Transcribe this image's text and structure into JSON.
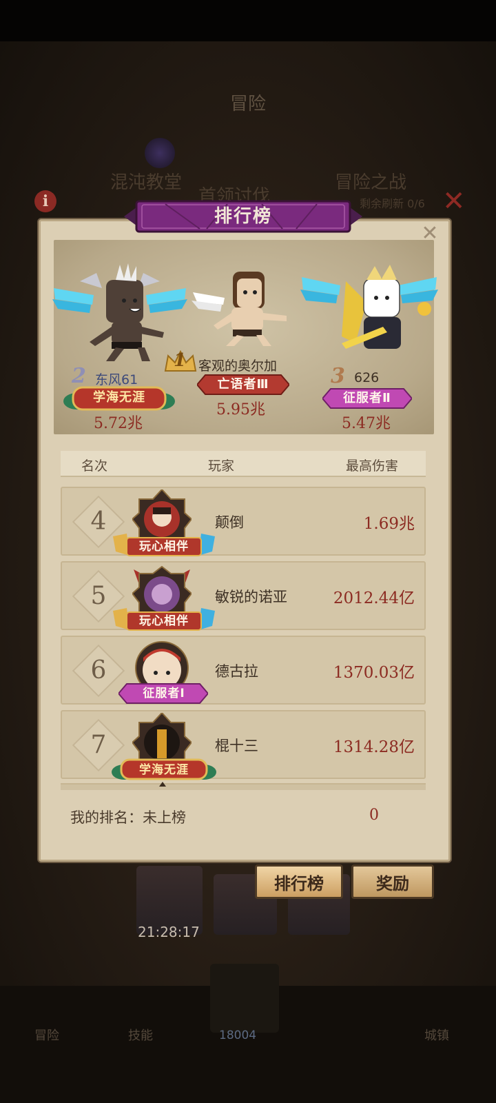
{
  "background": {
    "screen_title": "冒险",
    "left_label": "混沌教堂",
    "center_label": "首领讨伐",
    "right_label": "冒险之战",
    "right_sub": "剩余刷新 0/6",
    "timer": "21:28:17",
    "tabs": {
      "leaderboard": "排行榜",
      "rewards": "奖励"
    },
    "nav": {
      "left": "冒险",
      "second": "技能",
      "center_count": "18004",
      "right": "城镇"
    }
  },
  "panel": {
    "banner": "排行榜",
    "close_icon": "close-icon"
  },
  "podium": [
    {
      "rank": "2",
      "name": "东风61",
      "title": "学海无涯",
      "damage": "5.72兆"
    },
    {
      "rank": "1",
      "name": "客观的奥尔加",
      "title": "亡语者Ⅲ",
      "damage": "5.95兆"
    },
    {
      "rank": "3",
      "name": "626",
      "title": "征服者Ⅱ",
      "damage": "5.47兆"
    }
  ],
  "table": {
    "headers": {
      "rank": "名次",
      "player": "玩家",
      "damage": "最高伤害"
    },
    "rows": [
      {
        "rank": "4",
        "name": "颠倒",
        "title": "玩心相伴",
        "damage": "1.69兆"
      },
      {
        "rank": "5",
        "name": "敏锐的诺亚",
        "title": "玩心相伴",
        "damage": "2012.44亿"
      },
      {
        "rank": "6",
        "name": "德古拉",
        "title": "征服者Ⅰ",
        "damage": "1370.03亿"
      },
      {
        "rank": "7",
        "name": "棍十三",
        "title": "学海无涯",
        "damage": "1314.28亿"
      }
    ]
  },
  "my_rank": {
    "label": "我的排名：未上榜",
    "value": "0"
  },
  "colors": {
    "banner_purple": "#7a2a7e",
    "damage_red": "#8c2b22",
    "gold": "#e3b24a",
    "wing_cyan": "#3fd3f0"
  }
}
